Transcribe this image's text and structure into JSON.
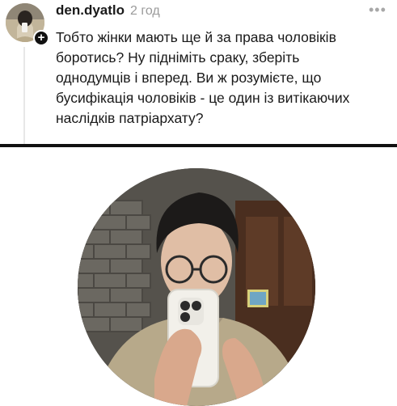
{
  "comment": {
    "username": "den.dyatlo",
    "time": "2 год",
    "more_icon": "more-horizontal-icon",
    "plus_icon": "+",
    "lines": [
      "Тобто жінки мають ще й за права чоловіків",
      "боротись? Ну підніміть сраку, зберіть",
      "однодумців і вперед. Ви ж розумієте, що",
      "бусифікація чоловіків - це один із витікаючих",
      "наслідків патріархату?"
    ]
  },
  "profile_photo": {
    "icon": "profile-avatar-large"
  },
  "colors": {
    "text": "#1a1a1a",
    "muted": "#9a9a9a",
    "divider": "#111111"
  }
}
